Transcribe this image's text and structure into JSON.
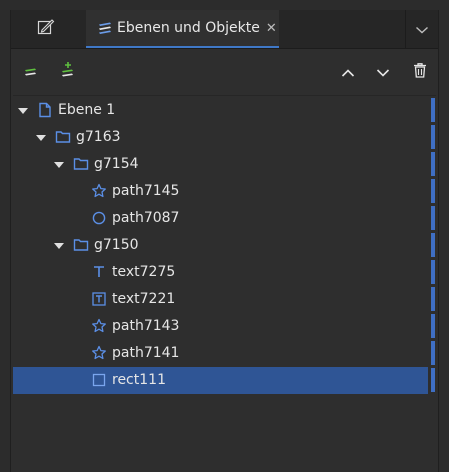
{
  "colors": {
    "accent": "#3f78c7",
    "selection": "#2f5595",
    "icon_blue": "#5b8fe6",
    "add_green": "#5fbf3f"
  },
  "tabs": {
    "edit_tab_icon": "edit-object-icon",
    "active": {
      "icon": "layers-icon",
      "label": "Ebenen und Objekte",
      "close": "✕"
    },
    "menu_icon": "chevron-down-icon"
  },
  "toolbar": {
    "left": [
      "add-layer-icon",
      "add-sublayer-icon"
    ],
    "right": [
      "move-up-icon",
      "move-down-icon",
      "delete-icon"
    ]
  },
  "tree": [
    {
      "label": "Ebene 1",
      "icon": "document-icon",
      "depth": 0,
      "expanded": true
    },
    {
      "label": "g7163",
      "icon": "folder-icon",
      "depth": 1,
      "expanded": true
    },
    {
      "label": "g7154",
      "icon": "folder-icon",
      "depth": 2,
      "expanded": true
    },
    {
      "label": "path7145",
      "icon": "star-icon",
      "depth": 3
    },
    {
      "label": "path7087",
      "icon": "circle-icon",
      "depth": 3
    },
    {
      "label": "g7150",
      "icon": "folder-icon",
      "depth": 2,
      "expanded": true
    },
    {
      "label": "text7275",
      "icon": "text-icon",
      "depth": 3
    },
    {
      "label": "text7221",
      "icon": "text-frame-icon",
      "depth": 3
    },
    {
      "label": "path7143",
      "icon": "star-icon",
      "depth": 3
    },
    {
      "label": "path7141",
      "icon": "star-icon",
      "depth": 3
    },
    {
      "label": "rect111",
      "icon": "rect-icon",
      "depth": 3,
      "selected": true
    }
  ]
}
